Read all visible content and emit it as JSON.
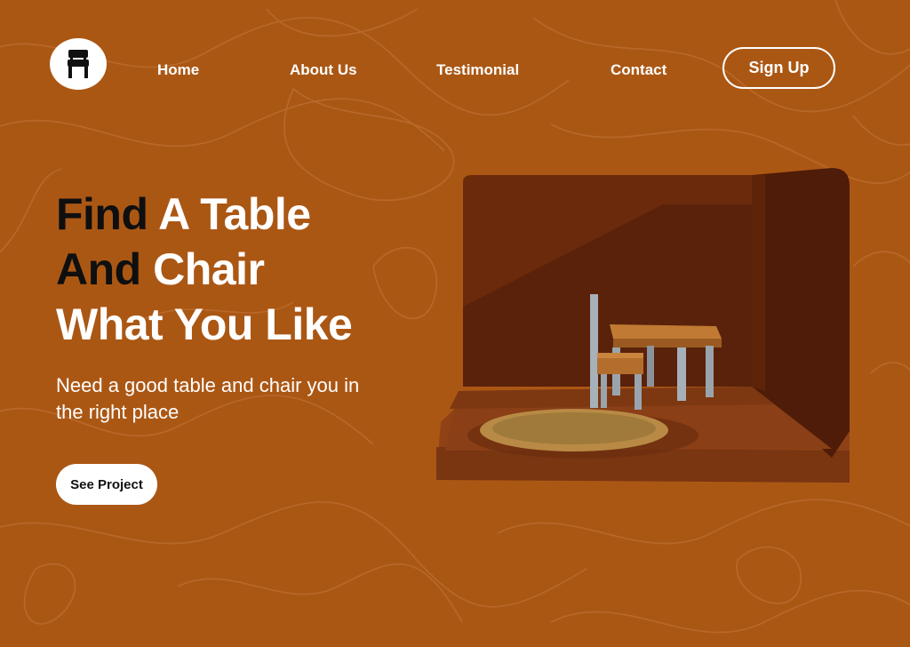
{
  "brand": {
    "logo_icon": "chair-icon"
  },
  "nav": {
    "items": [
      {
        "label": "Home"
      },
      {
        "label": "About Us"
      },
      {
        "label": "Testimonial"
      },
      {
        "label": "Contact"
      }
    ],
    "signup_label": "Sign Up"
  },
  "hero": {
    "title_line1_dark": "Find",
    "title_line1_light": "A Table",
    "title_line2_dark": "And",
    "title_line2_light": "Chair",
    "title_line3": "What You Like",
    "subtitle": "Need a good table and chair you in the right place",
    "cta_label": "See Project"
  },
  "colors": {
    "background": "#ab5714",
    "topo_lines": "#b86a2c",
    "title_dark": "#0f0f0f",
    "text_light": "#ffffff"
  }
}
